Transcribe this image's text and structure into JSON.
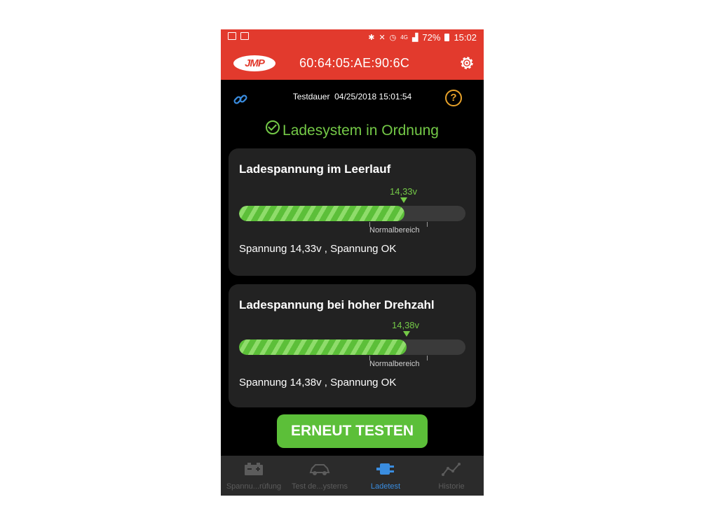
{
  "statusbar": {
    "network": "4G",
    "battery": "72%",
    "time": "15:02"
  },
  "appbar": {
    "logo_text": "JMP",
    "device_id": "60:64:05:AE:90:6C"
  },
  "info": {
    "testdauer_label": "Testdauer",
    "testdauer_value": "04/25/2018 15:01:54",
    "help_glyph": "?"
  },
  "status_message": "Ladesystem in Ordnung",
  "cards": [
    {
      "title": "Ladespannung im Leerlauf",
      "value_label": "14,33v",
      "fill_percent": 73,
      "range_label": "Normalbereich",
      "status_text": "Spannung 14,33v , Spannung OK"
    },
    {
      "title": "Ladespannung bei hoher Drehzahl",
      "value_label": "14,38v",
      "fill_percent": 74,
      "range_label": "Normalbereich",
      "status_text": "Spannung 14,38v , Spannung OK"
    }
  ],
  "retest_button": "ERNEUT TESTEN",
  "bottom_nav": [
    {
      "label": "Spannu...rüfung",
      "icon": "battery-icon",
      "active": false
    },
    {
      "label": "Test de...ysterns",
      "icon": "car-icon",
      "active": false
    },
    {
      "label": "Ladetest",
      "icon": "plug-icon",
      "active": true
    },
    {
      "label": "Historie",
      "icon": "history-chart-icon",
      "active": false
    }
  ],
  "colors": {
    "brand_red": "#e23a2d",
    "ok_green": "#74c947",
    "active_blue": "#3a8de0",
    "help_orange": "#e8a22a"
  }
}
